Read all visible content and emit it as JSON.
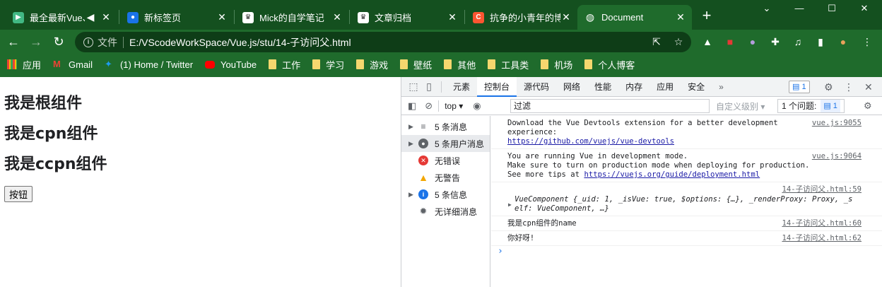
{
  "tabs": [
    {
      "title": "最全最新Vue、",
      "icon": "vue-icon",
      "color": "#41b883",
      "audio": true
    },
    {
      "title": "新标签页",
      "icon": "profile-icon",
      "color": "#1a73e8"
    },
    {
      "title": "Mick的自学笔记",
      "icon": "blog-icon",
      "color": "#ffffff"
    },
    {
      "title": "文章归档",
      "icon": "blog-icon",
      "color": "#ffffff"
    },
    {
      "title": "抗争的小青年的博",
      "icon": "csdn-icon",
      "color": "#fc5531"
    },
    {
      "title": "Document",
      "icon": "globe-icon",
      "color": "#ffffff",
      "active": true
    }
  ],
  "address": {
    "label": "文件",
    "url": "E:/VScodeWorkSpace/Vue.js/stu/14-子访问父.html"
  },
  "bookmarks": [
    "应用",
    "Gmail",
    "(1) Home / Twitter",
    "YouTube",
    "工作",
    "学习",
    "游戏",
    "壁纸",
    "其他",
    "工具类",
    "机场",
    "个人博客"
  ],
  "page": {
    "headings": [
      "我是根组件",
      "我是cpn组件",
      "我是ccpn组件"
    ],
    "button": "按钮"
  },
  "devtools": {
    "tabs": [
      "元素",
      "控制台",
      "源代码",
      "网络",
      "性能",
      "内存",
      "应用",
      "安全"
    ],
    "active_tab": "控制台",
    "badge_count": "1",
    "context": "top",
    "filter_value": "过滤",
    "levels": "自定义级别",
    "issues_label": "1 个问题:",
    "issues_count": "1",
    "sidebar": [
      {
        "label": "5 条消息",
        "icon": "list-icon",
        "arrow": true
      },
      {
        "label": "5 条用户消息",
        "icon": "user-icon",
        "arrow": true,
        "selected": true
      },
      {
        "label": "无错误",
        "icon": "error-icon",
        "arrow": false
      },
      {
        "label": "无警告",
        "icon": "warning-icon",
        "arrow": false
      },
      {
        "label": "5 条信息",
        "icon": "info-icon",
        "arrow": true
      },
      {
        "label": "无详细消息",
        "icon": "verbose-icon",
        "arrow": false
      }
    ],
    "messages": [
      {
        "lines": [
          "Download the Vue Devtools extension for a better development",
          "experience:"
        ],
        "link": "https://github.com/vuejs/vue-devtools",
        "source": "vue.js:9055"
      },
      {
        "lines": [
          "You are running Vue in development mode.",
          "Make sure to turn on production mode when deploying for production.",
          "See more tips at "
        ],
        "link": "https://vuejs.org/guide/deployment.html",
        "source": "vue.js:9064"
      },
      {
        "lines": [
          "VueComponent {_uid: 1, _isVue: true, $options: {…}, _renderProxy: Proxy, _s",
          "elf: VueComponent, …}"
        ],
        "source": "14-子访问父.html:59",
        "object": true
      },
      {
        "lines": [
          "我是cpn组件的name"
        ],
        "source": "14-子访问父.html:60"
      },
      {
        "lines": [
          "你好呀!"
        ],
        "source": "14-子访问父.html:62"
      }
    ]
  }
}
